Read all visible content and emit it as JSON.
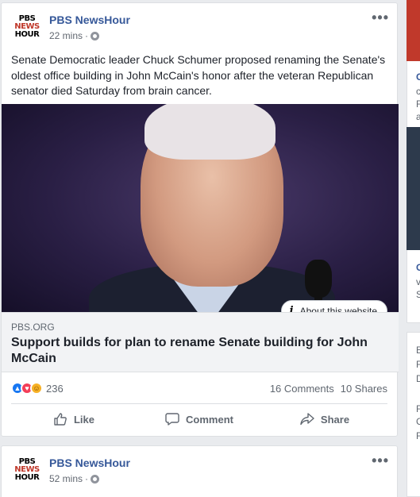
{
  "posts": [
    {
      "page_name": "PBS NewsHour",
      "logo": [
        "PBS",
        "NEWS",
        "HOUR"
      ],
      "time": "22 mins",
      "privacy_icon": "globe-icon",
      "text": "Senate Democratic leader Chuck Schumer proposed renaming the Senate's oldest office building in John McCain's honor after the veteran Republican senator died Saturday from brain cancer.",
      "about_label": "About this website",
      "link_domain": "PBS.ORG",
      "link_title": "Support builds for plan to rename Senate building for John McCain",
      "reaction_count": "236",
      "comments": "16 Comments",
      "shares": "10 Shares",
      "actions": {
        "like": "Like",
        "comment": "Comment",
        "share": "Share"
      }
    },
    {
      "page_name": "PBS NewsHour",
      "logo": [
        "PBS",
        "NEWS",
        "HOUR"
      ],
      "time": "52 mins",
      "privacy_icon": "globe-icon"
    }
  ],
  "right_column": {
    "fragments": [
      "C",
      "c",
      "F",
      "a",
      "C",
      "v",
      "S",
      "E",
      "F",
      "D",
      "F",
      "C",
      "F"
    ]
  },
  "colors": {
    "page_background": "#e9ebee",
    "link_blue": "#365899",
    "like_blue": "#1877f2",
    "love_red": "#f33e58",
    "haha_yellow": "#f7b125",
    "meta_gray": "#616770"
  }
}
